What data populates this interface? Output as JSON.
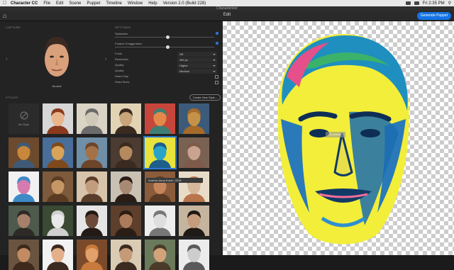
{
  "menubar": {
    "app": "Character CC",
    "items": [
      "File",
      "Edit",
      "Scene",
      "Puppet",
      "Timeline",
      "Window",
      "Help"
    ],
    "version": "Version 2.0 (Build 228)",
    "clock": "Fri 2:35 PM"
  },
  "window": {
    "title": "Characterizer"
  },
  "toolbar": {
    "title": "Edit",
    "generate_label": "Generate Puppet"
  },
  "capture": {
    "section_label": "CAPTURE",
    "thumb_label": "Neutral"
  },
  "settings": {
    "section_label": "SETTINGS",
    "sliders": [
      {
        "label": "Stylization",
        "value": 0.5
      },
      {
        "label": "Feature Exaggeration",
        "value": 0.5
      }
    ],
    "props": [
      {
        "label": "Fonts",
        "value": "Off"
      },
      {
        "label": "Resolution",
        "value": "400 px"
      },
      {
        "label": "Quality",
        "value": "Higher"
      },
      {
        "label": "Quality",
        "value": "Medium"
      },
      {
        "label": "Head Only",
        "checkbox": true
      },
      {
        "label": "Head Sizes",
        "checkbox": true
      }
    ]
  },
  "styles": {
    "section_label": "STYLES",
    "create_label": "Create New Style...",
    "no_style_label": "No Style",
    "tooltip": "Andrew Anna Kuehr, 2018",
    "tiles": [
      {
        "bg": "#d7d7d7",
        "skin": "#e9b58c",
        "hair": "#8b3a1e",
        "selected": false
      },
      {
        "bg": "#d9d4c4",
        "skin": "#cfc8b8",
        "hair": "#6b6b6b",
        "selected": false
      },
      {
        "bg": "#e2d3b5",
        "skin": "#caa47a",
        "hair": "#3a2a1f",
        "selected": false
      },
      {
        "bg": "#c7463b",
        "skin": "#e38a4a",
        "hair": "#3f7e74",
        "selected": false
      },
      {
        "bg": "#3c5b7a",
        "skin": "#c69247",
        "hair": "#a66a2a",
        "selected": false
      },
      {
        "bg": "#6c4a2d",
        "skin": "#c8873a",
        "hair": "#3e5a77",
        "selected": false
      },
      {
        "bg": "#4a6e9a",
        "skin": "#d9a35a",
        "hair": "#7f4a1b",
        "selected": false
      },
      {
        "bg": "#6f8fa8",
        "skin": "#a47249",
        "hair": "#6d4529",
        "selected": false
      },
      {
        "bg": "#4b3b30",
        "skin": "#b58a5e",
        "hair": "#3a2a20",
        "selected": false
      },
      {
        "bg": "#e8e23a",
        "skin": "#2aa3c9",
        "hair": "#1d5f8c",
        "selected": true
      },
      {
        "bg": "#7a6253",
        "skin": "#c9a290",
        "hair": "#7d5a4a",
        "selected": false
      },
      {
        "bg": "#f1f1f1",
        "skin": "#d57bb0",
        "hair": "#3d8ac7",
        "selected": false
      },
      {
        "bg": "#7d5a3b",
        "skin": "#c59766",
        "hair": "#5a3b22",
        "selected": false
      },
      {
        "bg": "#d7c4aa",
        "skin": "#c29d7d",
        "hair": "#5a3d2a",
        "selected": false
      },
      {
        "bg": "#c9c2b4",
        "skin": "#a88a74",
        "hair": "#2a1d15",
        "selected": false
      },
      {
        "bg": "#8a5c3c",
        "skin": "#c4855a",
        "hair": "#5a3a24",
        "selected": false
      },
      {
        "bg": "#e8dcc8",
        "skin": "#d7b79a",
        "hair": "#b8744a",
        "selected": false
      },
      {
        "bg": "#4d5a4c",
        "skin": "#a6806a",
        "hair": "#2e2a25",
        "selected": false
      },
      {
        "bg": "#3a4a33",
        "skin": "#e9e9e9",
        "hair": "#cfcfcf",
        "selected": false
      },
      {
        "bg": "#e5e5e5",
        "skin": "#6b4a3a",
        "hair": "#241a15",
        "selected": false
      },
      {
        "bg": "#5d3f2c",
        "skin": "#ad7b5a",
        "hair": "#2a1d15",
        "selected": false
      },
      {
        "bg": "#ededed",
        "skin": "#dedede",
        "hair": "#777777",
        "selected": false
      },
      {
        "bg": "#c5b59e",
        "skin": "#c59d7c",
        "hair": "#1f1a16",
        "selected": false
      },
      {
        "bg": "#6a5440",
        "skin": "#c28b63",
        "hair": "#3d2a1d",
        "selected": false
      },
      {
        "bg": "#f2f2f2",
        "skin": "#e3b08b",
        "hair": "#3b2a20",
        "selected": false
      },
      {
        "bg": "#7b4a2b",
        "skin": "#e2a06a",
        "hair": "#c77a3b",
        "selected": false
      },
      {
        "bg": "#d9cbb4",
        "skin": "#c49a77",
        "hair": "#3b2b20",
        "selected": false
      },
      {
        "bg": "#6a7a5a",
        "skin": "#d2a27a",
        "hair": "#4a3a2a",
        "selected": false
      },
      {
        "bg": "#ececec",
        "skin": "#cdcdcd",
        "hair": "#5a5a5a",
        "selected": false
      }
    ]
  },
  "preview": {
    "tag": "Emoticon"
  }
}
